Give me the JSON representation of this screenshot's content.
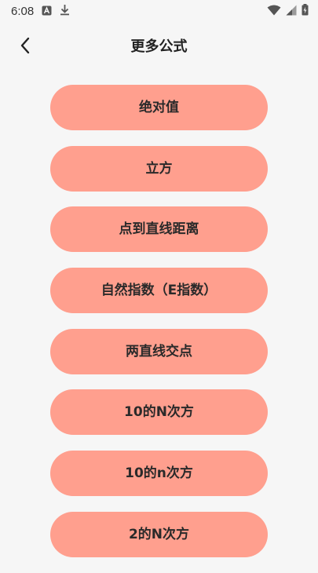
{
  "status_bar": {
    "time": "6:08",
    "icons": [
      "a-notification-icon",
      "download-icon",
      "wifi-icon",
      "cellular-signal-icon",
      "battery-icon"
    ]
  },
  "header": {
    "title": "更多公式",
    "back_icon": "chevron-left-icon"
  },
  "formulas": [
    {
      "label": "绝对值"
    },
    {
      "label": "立方"
    },
    {
      "label": "点到直线距离"
    },
    {
      "label": "自然指数（E指数）"
    },
    {
      "label": "两直线交点"
    },
    {
      "label": "10的N次方"
    },
    {
      "label": "10的n次方"
    },
    {
      "label": "2的N次方"
    }
  ],
  "colors": {
    "button_bg": "#ff9f8e",
    "page_bg": "#f6f6f6",
    "text": "#222222"
  }
}
